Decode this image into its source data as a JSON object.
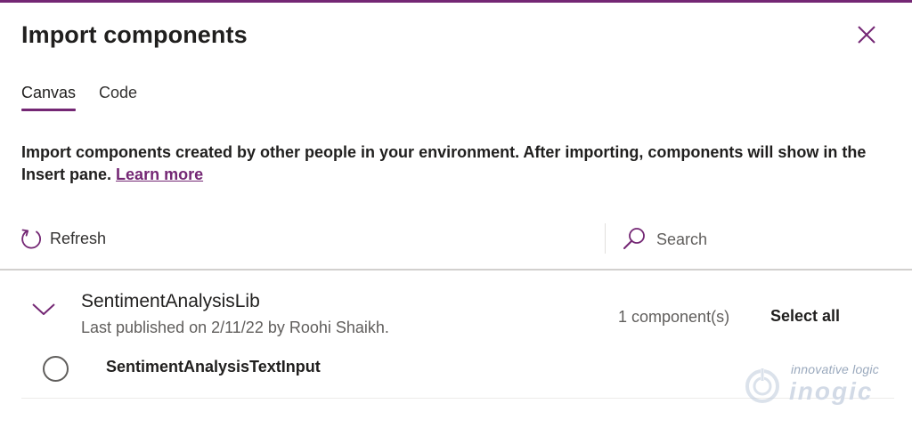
{
  "dialog": {
    "title": "Import components"
  },
  "tabs": [
    {
      "label": "Canvas",
      "active": true
    },
    {
      "label": "Code",
      "active": false
    }
  ],
  "description": {
    "text": "Import components created by other people in your environment. After importing, components will show in the Insert pane.",
    "link": "Learn more"
  },
  "toolbar": {
    "refresh_label": "Refresh",
    "search_placeholder": "Search"
  },
  "library": {
    "name": "SentimentAnalysisLib",
    "meta": "Last published on 2/11/22 by Roohi Shaikh.",
    "count": "1 component(s)",
    "select_all": "Select all",
    "components": [
      {
        "name": "SentimentAnalysisTextInput",
        "selected": false
      }
    ]
  },
  "watermark": {
    "tagline": "innovative logic",
    "brand": "inogic"
  },
  "colors": {
    "accent": "#742774",
    "text_primary": "#201f1e",
    "text_secondary": "#605e5c",
    "divider": "#d2d0ce"
  },
  "icons": {
    "close": "close-icon",
    "refresh": "refresh-icon",
    "search": "search-icon",
    "expand": "chevron-down-icon"
  }
}
